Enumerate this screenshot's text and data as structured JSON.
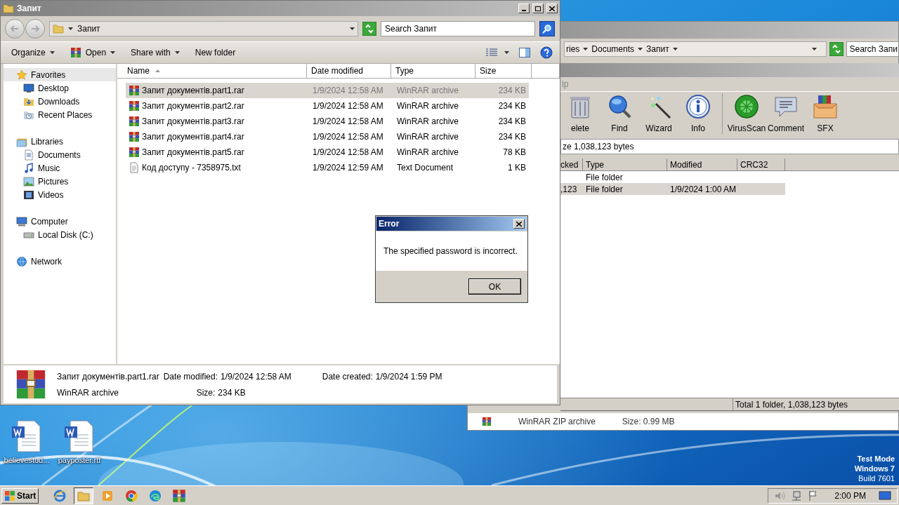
{
  "back_explorer": {
    "breadcrumb": [
      "ries",
      "Documents",
      "Запит"
    ],
    "search_placeholder": "Search Запи",
    "details": {
      "type": "WinRAR ZIP archive",
      "size": "Size: 0.99 MB"
    }
  },
  "winrar": {
    "menu": [
      "lp"
    ],
    "tools": [
      {
        "label": "elete",
        "kind": "trash"
      },
      {
        "label": "Find",
        "kind": "find"
      },
      {
        "label": "Wizard",
        "kind": "wizard"
      },
      {
        "label": "Info",
        "kind": "info"
      },
      {
        "label": "VirusScan",
        "kind": "virus"
      },
      {
        "label": "Comment",
        "kind": "comment"
      },
      {
        "label": "SFX",
        "kind": "sfx"
      }
    ],
    "path": "ze 1,038,123 bytes",
    "columns": [
      "cked",
      "Type",
      "Modified",
      "CRC32"
    ],
    "rows": [
      {
        "type": "File folder",
        "selected": false
      },
      {
        "packed": ",123",
        "type": "File folder",
        "modified": "1/9/2024 1:00 AM",
        "selected": true
      }
    ],
    "status": "Total 1 folder, 1,038,123 bytes"
  },
  "explorer": {
    "title": "Запит",
    "address": "Запит",
    "search_placeholder": "Search Запит",
    "commands": [
      {
        "label": "Organize",
        "menu": true
      },
      {
        "label": "Open",
        "menu": true,
        "kind": "open"
      },
      {
        "label": "Share with",
        "menu": true
      },
      {
        "label": "New folder",
        "menu": false
      }
    ],
    "nav": [
      {
        "label": "Favorites",
        "kind": "star",
        "selected": true,
        "children": [
          {
            "label": "Desktop",
            "kind": "desktop",
            "selected": false
          },
          {
            "label": "Downloads",
            "kind": "downloads",
            "selected": false
          },
          {
            "label": "Recent Places",
            "kind": "recent",
            "selected": false
          }
        ]
      },
      {
        "label": "Libraries",
        "kind": "library",
        "selected": false,
        "children": [
          {
            "label": "Documents",
            "kind": "documents",
            "selected": false
          },
          {
            "label": "Music",
            "kind": "music",
            "selected": false
          },
          {
            "label": "Pictures",
            "kind": "pictures",
            "selected": false
          },
          {
            "label": "Videos",
            "kind": "videos",
            "selected": false
          }
        ]
      },
      {
        "label": "Computer",
        "kind": "computer",
        "selected": false,
        "children": [
          {
            "label": "Local Disk (C:)",
            "kind": "disk",
            "selected": false
          }
        ]
      },
      {
        "label": "Network",
        "kind": "network",
        "selected": false
      }
    ],
    "columns": [
      {
        "label": "Name",
        "sorted": true
      },
      {
        "label": "Date modified",
        "sorted": false
      },
      {
        "label": "Type",
        "sorted": false
      },
      {
        "label": "Size",
        "sorted": false
      }
    ],
    "files": [
      {
        "name": "Запит документів.part1.rar",
        "date": "1/9/2024 12:58 AM",
        "type": "WinRAR archive",
        "size": "234 KB",
        "kind": "rar",
        "selected": true
      },
      {
        "name": "Запит документів.part2.rar",
        "date": "1/9/2024 12:58 AM",
        "type": "WinRAR archive",
        "size": "234 KB",
        "kind": "rar",
        "selected": false
      },
      {
        "name": "Запит документів.part3.rar",
        "date": "1/9/2024 12:58 AM",
        "type": "WinRAR archive",
        "size": "234 KB",
        "kind": "rar",
        "selected": false
      },
      {
        "name": "Запит документів.part4.rar",
        "date": "1/9/2024 12:58 AM",
        "type": "WinRAR archive",
        "size": "234 KB",
        "kind": "rar",
        "selected": false
      },
      {
        "name": "Запит документів.part5.rar",
        "date": "1/9/2024 12:58 AM",
        "type": "WinRAR archive",
        "size": "78 KB",
        "kind": "rar",
        "selected": false
      },
      {
        "name": "Код доступу - 7358975.txt",
        "date": "1/9/2024 12:59 AM",
        "type": "Text Document",
        "size": "1 KB",
        "kind": "txt",
        "selected": false
      }
    ],
    "details": {
      "name": "Запит документів.part1.rar",
      "type": "WinRAR archive",
      "modified_label": "Date modified:",
      "modified": "1/9/2024 12:58 AM",
      "size_label": "Size:",
      "size": "234 KB",
      "created_label": "Date created:",
      "created": "1/9/2024 1:59 PM"
    }
  },
  "dialog": {
    "title": "Error",
    "message": "The specified password is incorrect.",
    "button": "OK"
  },
  "desktop_icons": [
    {
      "label": "believestud..."
    },
    {
      "label": "payposter.rtf"
    }
  ],
  "os_notice": [
    "Test Mode",
    "Windows 7",
    "Build 7601"
  ],
  "taskbar": {
    "start": "Start",
    "apps": [
      {
        "kind": "ie",
        "selected": false
      },
      {
        "kind": "explorer",
        "selected": true
      },
      {
        "kind": "media",
        "selected": false
      },
      {
        "kind": "chrome",
        "selected": false
      },
      {
        "kind": "edge",
        "selected": false
      },
      {
        "kind": "winrar",
        "selected": false
      }
    ],
    "clock": "2:00 PM"
  }
}
